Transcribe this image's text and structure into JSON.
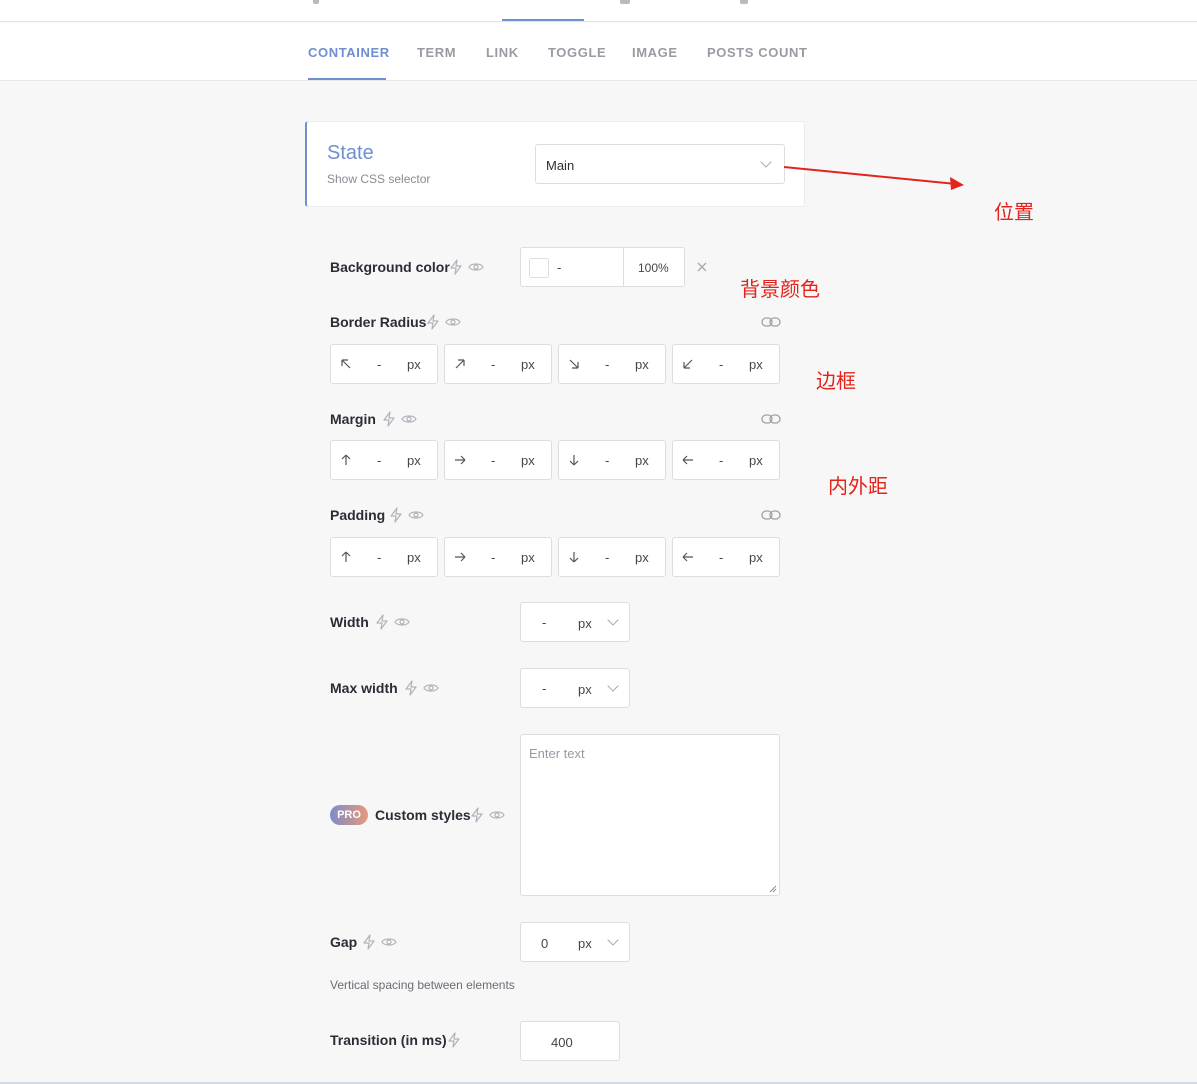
{
  "tabs": {
    "items": [
      {
        "label": "CONTAINER",
        "active": true
      },
      {
        "label": "TERM",
        "active": false
      },
      {
        "label": "LINK",
        "active": false
      },
      {
        "label": "TOGGLE",
        "active": false
      },
      {
        "label": "IMAGE",
        "active": false
      },
      {
        "label": "POSTS COUNT",
        "active": false
      }
    ]
  },
  "state": {
    "title": "State",
    "subtitle": "Show CSS selector",
    "selected": "Main"
  },
  "background_color": {
    "label": "Background color",
    "value": "-",
    "opacity": "100%"
  },
  "border_radius": {
    "label": "Border Radius",
    "values": [
      "-",
      "-",
      "-",
      "-"
    ],
    "unit": "px"
  },
  "margin": {
    "label": "Margin",
    "values": [
      "-",
      "-",
      "-",
      "-"
    ],
    "unit": "px"
  },
  "padding": {
    "label": "Padding",
    "values": [
      "-",
      "-",
      "-",
      "-"
    ],
    "unit": "px"
  },
  "width": {
    "label": "Width",
    "value": "-",
    "unit": "px"
  },
  "max_width": {
    "label": "Max width",
    "value": "-",
    "unit": "px"
  },
  "custom_styles": {
    "badge": "PRO",
    "label": "Custom styles",
    "placeholder": "Enter text"
  },
  "gap": {
    "label": "Gap",
    "value": "0",
    "unit": "px",
    "help": "Vertical spacing between elements"
  },
  "transition": {
    "label": "Transition (in ms)",
    "value": "400"
  },
  "annotations": {
    "position": "位置",
    "background": "背景颜色",
    "border": "边框",
    "spacing": "内外距"
  },
  "colors": {
    "accent": "#6f8fd1",
    "annotation": "#e2241c"
  }
}
